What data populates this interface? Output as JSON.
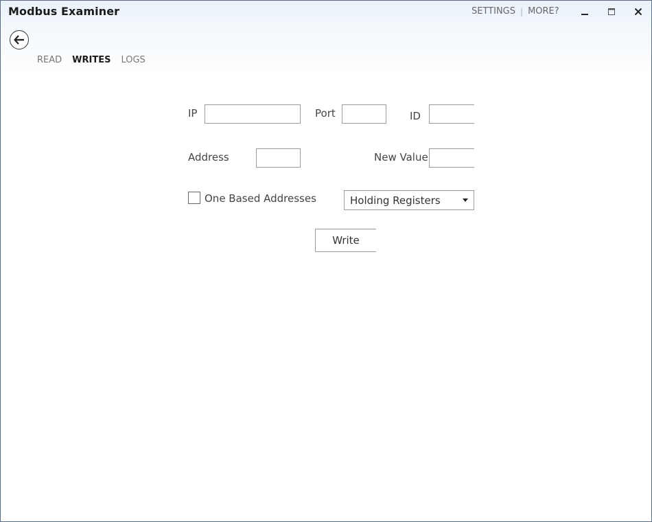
{
  "app": {
    "title": "Modbus Examiner"
  },
  "top_links": {
    "settings": "SETTINGS",
    "separator": "|",
    "more": "MORE?"
  },
  "window_controls": {
    "minimize_icon": "minimize-icon",
    "maximize_icon": "maximize-icon",
    "close_icon": "close-icon"
  },
  "nav": {
    "back_icon": "arrow-left-circle-icon",
    "tabs": [
      {
        "label": "READ",
        "active": false
      },
      {
        "label": "WRITES",
        "active": true
      },
      {
        "label": "LOGS",
        "active": false
      }
    ]
  },
  "form": {
    "ip": {
      "label": "IP",
      "value": ""
    },
    "port": {
      "label": "Port",
      "value": ""
    },
    "id": {
      "label": "ID",
      "value": ""
    },
    "address": {
      "label": "Address",
      "value": ""
    },
    "new_value": {
      "label": "New Value",
      "value": ""
    },
    "one_based": {
      "label": "One Based Addresses",
      "checked": false
    },
    "register_type": {
      "selected": "Holding Registers"
    },
    "write_button": "Write"
  },
  "colors": {
    "border": "#9a9a9a",
    "title_gradient_top": "#eaf2fa",
    "active_tab": "#1a1a1a",
    "inactive_tab": "#777777"
  }
}
